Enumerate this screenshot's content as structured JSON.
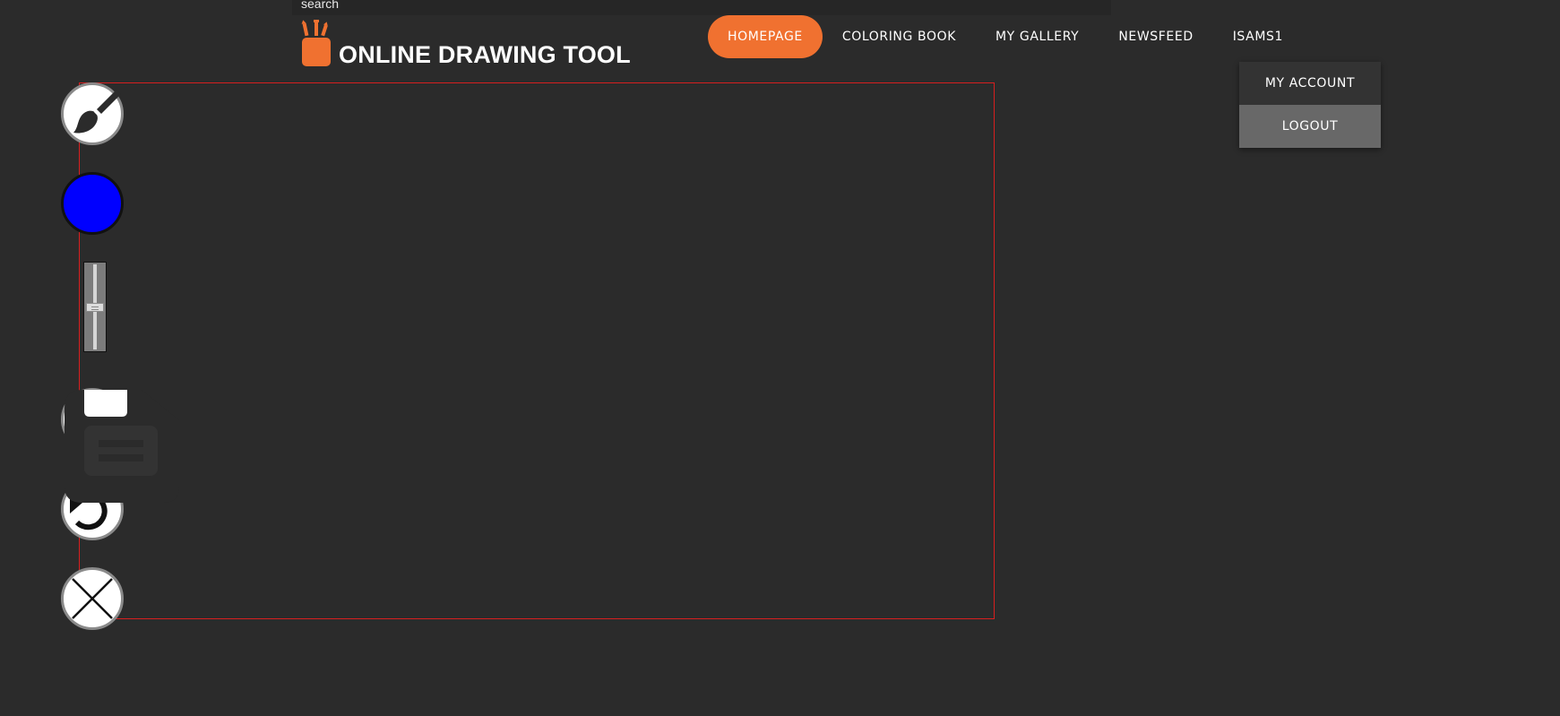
{
  "search": {
    "placeholder": "search"
  },
  "logo": {
    "title": "ONLINE DRAWING TOOL",
    "icon": "pencil-cup-icon",
    "color": "#f07130"
  },
  "nav": {
    "items": [
      {
        "label": "HOMEPAGE",
        "active": true
      },
      {
        "label": "COLORING BOOK",
        "active": false
      },
      {
        "label": "MY GALLERY",
        "active": false
      },
      {
        "label": "NEWSFEED",
        "active": false
      },
      {
        "label": "ISAMS1",
        "active": false
      }
    ],
    "accent": "#f07130"
  },
  "user_menu": {
    "items": [
      {
        "label": "MY ACCOUNT"
      },
      {
        "label": "LOGOUT",
        "hovered": true
      }
    ]
  },
  "toolbar": {
    "tools": [
      {
        "name": "brush-tool",
        "icon": "paint-brush-icon"
      },
      {
        "name": "color-picker",
        "icon": "color-swatch-icon",
        "color": "#0000ff"
      },
      {
        "name": "brush-size-slider",
        "icon": "vertical-slider"
      },
      {
        "name": "save-tool",
        "icon": "floppy-disk-icon"
      },
      {
        "name": "undo-tool",
        "icon": "undo-arrow-icon"
      },
      {
        "name": "clear-tool",
        "icon": "close-x-icon"
      }
    ],
    "brush_size_level": 0.5
  },
  "canvas": {
    "border_color": "#d81f1f",
    "background": "#2b2b2b"
  }
}
